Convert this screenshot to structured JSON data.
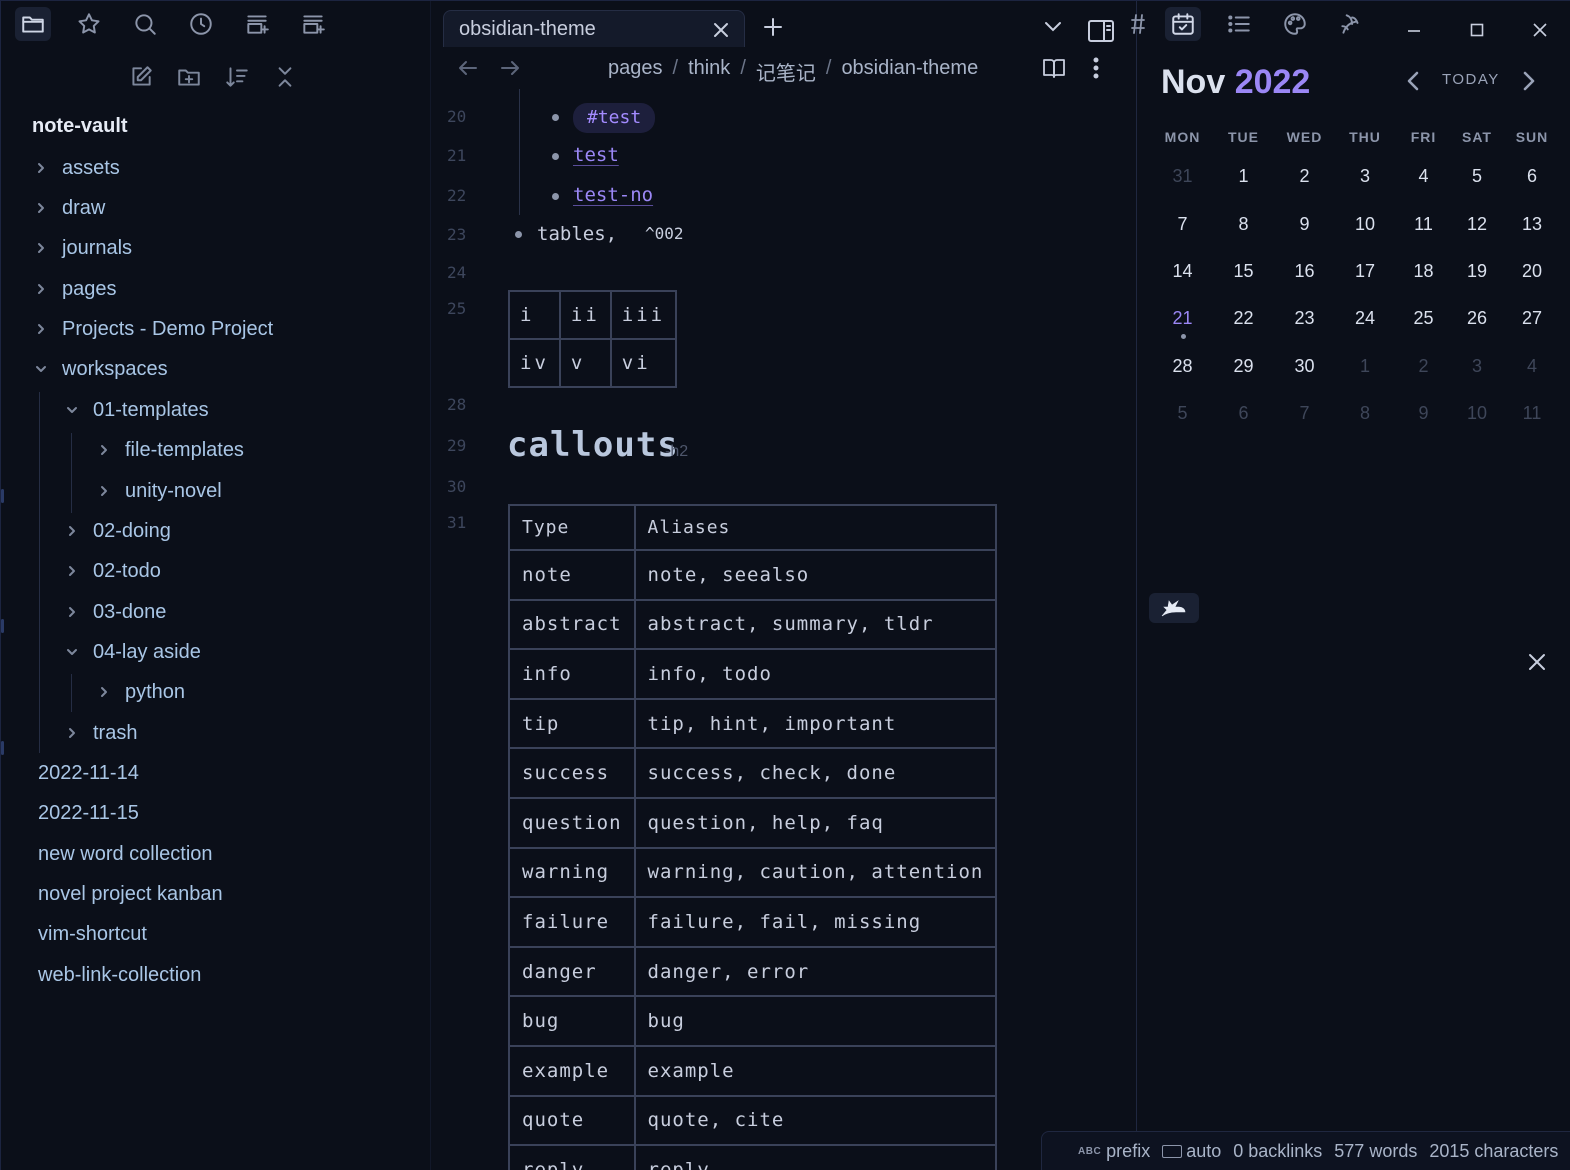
{
  "left_ribbon": {
    "icons": [
      "folder-icon",
      "star-icon",
      "search-icon",
      "clock-icon",
      "new-tab-stack-icon",
      "tab-stack-icon"
    ]
  },
  "file_explorer": {
    "vault_name": "note-vault",
    "items": [
      {
        "label": "assets",
        "type": "folder",
        "expanded": false,
        "depth": 0
      },
      {
        "label": "draw",
        "type": "folder",
        "expanded": false,
        "depth": 0
      },
      {
        "label": "journals",
        "type": "folder",
        "expanded": false,
        "depth": 0
      },
      {
        "label": "pages",
        "type": "folder",
        "expanded": false,
        "depth": 0
      },
      {
        "label": "Projects - Demo Project",
        "type": "folder",
        "expanded": false,
        "depth": 0
      },
      {
        "label": "workspaces",
        "type": "folder",
        "expanded": true,
        "depth": 0
      },
      {
        "label": "01-templates",
        "type": "folder",
        "expanded": true,
        "depth": 1
      },
      {
        "label": "file-templates",
        "type": "folder",
        "expanded": false,
        "depth": 2
      },
      {
        "label": "unity-novel",
        "type": "folder",
        "expanded": false,
        "depth": 2
      },
      {
        "label": "02-doing",
        "type": "folder",
        "expanded": false,
        "depth": 1
      },
      {
        "label": "02-todo",
        "type": "folder",
        "expanded": false,
        "depth": 1
      },
      {
        "label": "03-done",
        "type": "folder",
        "expanded": false,
        "depth": 1
      },
      {
        "label": "04-lay aside",
        "type": "folder",
        "expanded": true,
        "depth": 1
      },
      {
        "label": "python",
        "type": "folder",
        "expanded": false,
        "depth": 2
      },
      {
        "label": "trash",
        "type": "folder",
        "expanded": false,
        "depth": 1
      },
      {
        "label": "2022-11-14",
        "type": "file",
        "depth": 0
      },
      {
        "label": "2022-11-15",
        "type": "file",
        "depth": 0
      },
      {
        "label": "new word collection",
        "type": "file",
        "depth": 0
      },
      {
        "label": "novel project kanban",
        "type": "file",
        "depth": 0
      },
      {
        "label": "vim-shortcut",
        "type": "file",
        "depth": 0
      },
      {
        "label": "web-link-collection",
        "type": "file",
        "depth": 0
      }
    ]
  },
  "editor": {
    "tab_title": "obsidian-theme",
    "breadcrumb": [
      "pages",
      "think",
      "记笔记",
      "obsidian-theme"
    ],
    "line_numbers": [
      "20",
      "21",
      "22",
      "23",
      "24",
      "25",
      "28",
      "29",
      "30",
      "31"
    ],
    "list": {
      "tag": "#test",
      "link1": "test",
      "link2": "test-no",
      "tables_text": "tables,",
      "block_ref": "^002"
    },
    "mini_table": [
      [
        "i",
        "ii",
        "iii"
      ],
      [
        "iv",
        "v",
        "vi"
      ]
    ],
    "heading": {
      "text": "callouts",
      "marker": "-h2"
    },
    "callout_table": {
      "headers": [
        "Type",
        "Aliases"
      ],
      "rows": [
        [
          "note",
          "note, seealso"
        ],
        [
          "abstract",
          "abstract, summary, tldr"
        ],
        [
          "info",
          "info, todo"
        ],
        [
          "tip",
          "tip, hint, important"
        ],
        [
          "success",
          "success, check, done"
        ],
        [
          "question",
          "question, help, faq"
        ],
        [
          "warning",
          "warning, caution, attention"
        ],
        [
          "failure",
          "failure, fail, missing"
        ],
        [
          "danger",
          "danger, error"
        ],
        [
          "bug",
          "bug"
        ],
        [
          "example",
          "example"
        ],
        [
          "quote",
          "quote, cite"
        ],
        [
          "reply",
          "reply"
        ]
      ]
    }
  },
  "right_panel": {
    "tabs": [
      "tag-icon",
      "calendar-icon",
      "outline-icon",
      "palette-icon",
      "plugin-icon"
    ],
    "calendar": {
      "month": "Nov",
      "year": "2022",
      "today_label": "TODAY",
      "weekdays": [
        "MON",
        "TUE",
        "WED",
        "THU",
        "FRI",
        "SAT",
        "SUN"
      ],
      "weeks": [
        [
          "31",
          "1",
          "2",
          "3",
          "4",
          "5",
          "6"
        ],
        [
          "7",
          "8",
          "9",
          "10",
          "11",
          "12",
          "13"
        ],
        [
          "14",
          "15",
          "16",
          "17",
          "18",
          "19",
          "20"
        ],
        [
          "21",
          "22",
          "23",
          "24",
          "25",
          "26",
          "27"
        ],
        [
          "28",
          "29",
          "30",
          "1",
          "2",
          "3",
          "4"
        ],
        [
          "5",
          "6",
          "7",
          "8",
          "9",
          "10",
          "11"
        ]
      ],
      "today": "21"
    }
  },
  "status_bar": {
    "spell_badge": "ABC",
    "prefix": "prefix",
    "input_mode": "auto",
    "backlinks": "0 backlinks",
    "words": "577 words",
    "characters": "2015 characters"
  },
  "colors": {
    "background": "#0b0f19",
    "accent": "#9b87f5",
    "text": "#c8cede",
    "tag_bg": "#1d1f3c"
  }
}
